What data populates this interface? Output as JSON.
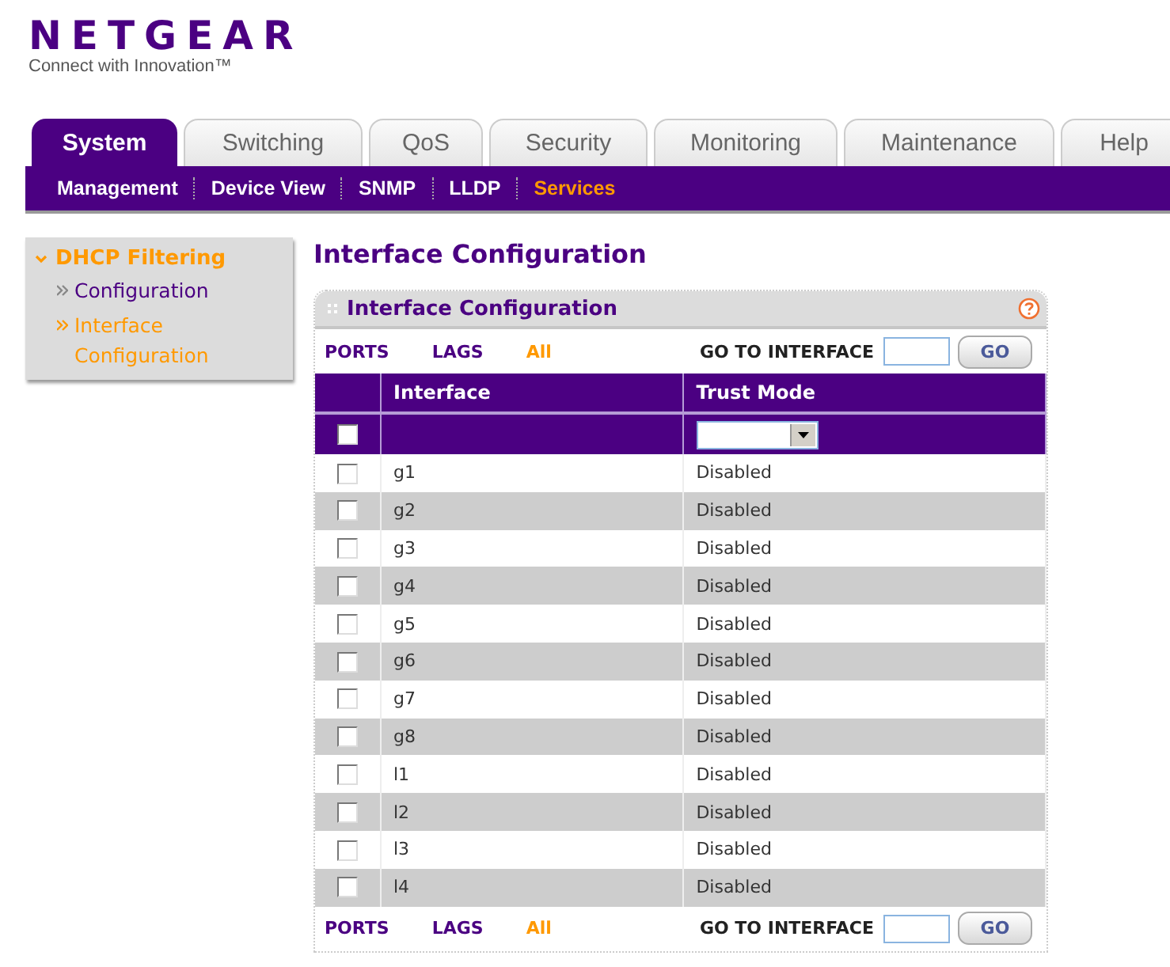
{
  "logo": {
    "brand": "NETGEAR",
    "tagline": "Connect with Innovation™"
  },
  "tabs": [
    {
      "label": "System",
      "selected": true
    },
    {
      "label": "Switching",
      "selected": false
    },
    {
      "label": "QoS",
      "selected": false
    },
    {
      "label": "Security",
      "selected": false
    },
    {
      "label": "Monitoring",
      "selected": false
    },
    {
      "label": "Maintenance",
      "selected": false
    },
    {
      "label": "Help",
      "selected": false
    }
  ],
  "subnav": [
    {
      "label": "Management",
      "selected": false
    },
    {
      "label": "Device View",
      "selected": false
    },
    {
      "label": "SNMP",
      "selected": false
    },
    {
      "label": "LLDP",
      "selected": false
    },
    {
      "label": "Services",
      "selected": true
    }
  ],
  "sidebar": {
    "group": {
      "label": "DHCP Filtering",
      "expanded": true
    },
    "items": [
      {
        "label": "Configuration",
        "selected": false
      },
      {
        "label": "Interface Configuration",
        "selected": true
      }
    ]
  },
  "page_title": "Interface Configuration",
  "panel": {
    "title": "Interface Configuration",
    "filter_top": {
      "links": [
        {
          "label": "PORTS",
          "selected": false
        },
        {
          "label": "LAGS",
          "selected": false
        },
        {
          "label": "All",
          "selected": true
        }
      ],
      "goto_label": "GO TO INTERFACE",
      "go_button": "GO"
    },
    "table": {
      "columns": [
        "Interface",
        "Trust Mode"
      ],
      "select_all": {
        "checked": false
      },
      "rows": [
        {
          "checked": false,
          "interface": "g1",
          "trust_mode": "Disabled"
        },
        {
          "checked": false,
          "interface": "g2",
          "trust_mode": "Disabled"
        },
        {
          "checked": false,
          "interface": "g3",
          "trust_mode": "Disabled"
        },
        {
          "checked": false,
          "interface": "g4",
          "trust_mode": "Disabled"
        },
        {
          "checked": false,
          "interface": "g5",
          "trust_mode": "Disabled"
        },
        {
          "checked": false,
          "interface": "g6",
          "trust_mode": "Disabled"
        },
        {
          "checked": false,
          "interface": "g7",
          "trust_mode": "Disabled"
        },
        {
          "checked": false,
          "interface": "g8",
          "trust_mode": "Disabled"
        },
        {
          "checked": false,
          "interface": "l1",
          "trust_mode": "Disabled"
        },
        {
          "checked": false,
          "interface": "l2",
          "trust_mode": "Disabled"
        },
        {
          "checked": false,
          "interface": "l3",
          "trust_mode": "Disabled"
        },
        {
          "checked": false,
          "interface": "l4",
          "trust_mode": "Disabled"
        }
      ]
    },
    "filter_bottom": {
      "links": [
        {
          "label": "PORTS",
          "selected": false
        },
        {
          "label": "LAGS",
          "selected": false
        },
        {
          "label": "All",
          "selected": true
        }
      ],
      "goto_label": "GO TO INTERFACE",
      "go_button": "GO"
    }
  }
}
